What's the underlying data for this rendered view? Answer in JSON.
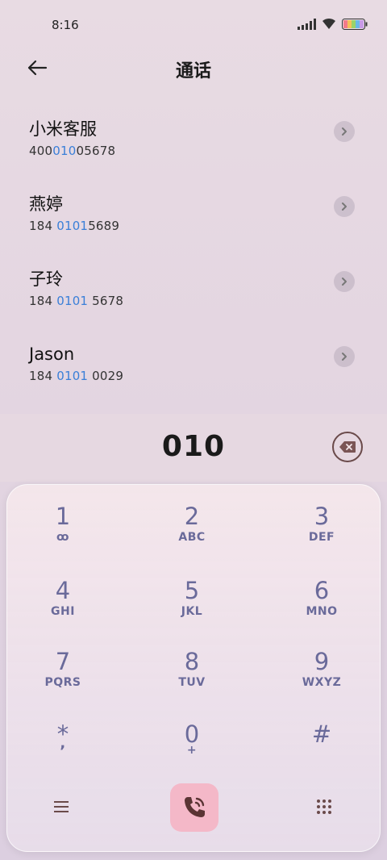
{
  "status": {
    "time": "8:16"
  },
  "header": {
    "title": "通话"
  },
  "contacts": [
    {
      "name": "小米客服",
      "num_pre": "400",
      "num_hl": "010",
      "num_post": "05678"
    },
    {
      "name": "燕婷",
      "num_pre": "184 ",
      "num_hl": "0101",
      "num_post": "5689"
    },
    {
      "name": "子玲",
      "num_pre": "184 ",
      "num_hl": "0101",
      "num_post": " 5678"
    },
    {
      "name": "Jason",
      "num_pre": "184 ",
      "num_hl": "0101",
      "num_post": " 0029"
    }
  ],
  "dial": {
    "digits": "010"
  },
  "keypad": {
    "keys": [
      {
        "digit": "1",
        "letters": "ꝏ"
      },
      {
        "digit": "2",
        "letters": "ABC"
      },
      {
        "digit": "3",
        "letters": "DEF"
      },
      {
        "digit": "4",
        "letters": "GHI"
      },
      {
        "digit": "5",
        "letters": "JKL"
      },
      {
        "digit": "6",
        "letters": "MNO"
      },
      {
        "digit": "7",
        "letters": "PQRS"
      },
      {
        "digit": "8",
        "letters": "TUV"
      },
      {
        "digit": "9",
        "letters": "WXYZ"
      },
      {
        "digit": "*",
        "letters": ","
      },
      {
        "digit": "0",
        "letters": "+"
      },
      {
        "digit": "#",
        "letters": ""
      }
    ]
  },
  "colors": {
    "highlight": "#3a7fd8",
    "key_text": "#6a6a9a",
    "call_bg": "#f4b8c8"
  }
}
